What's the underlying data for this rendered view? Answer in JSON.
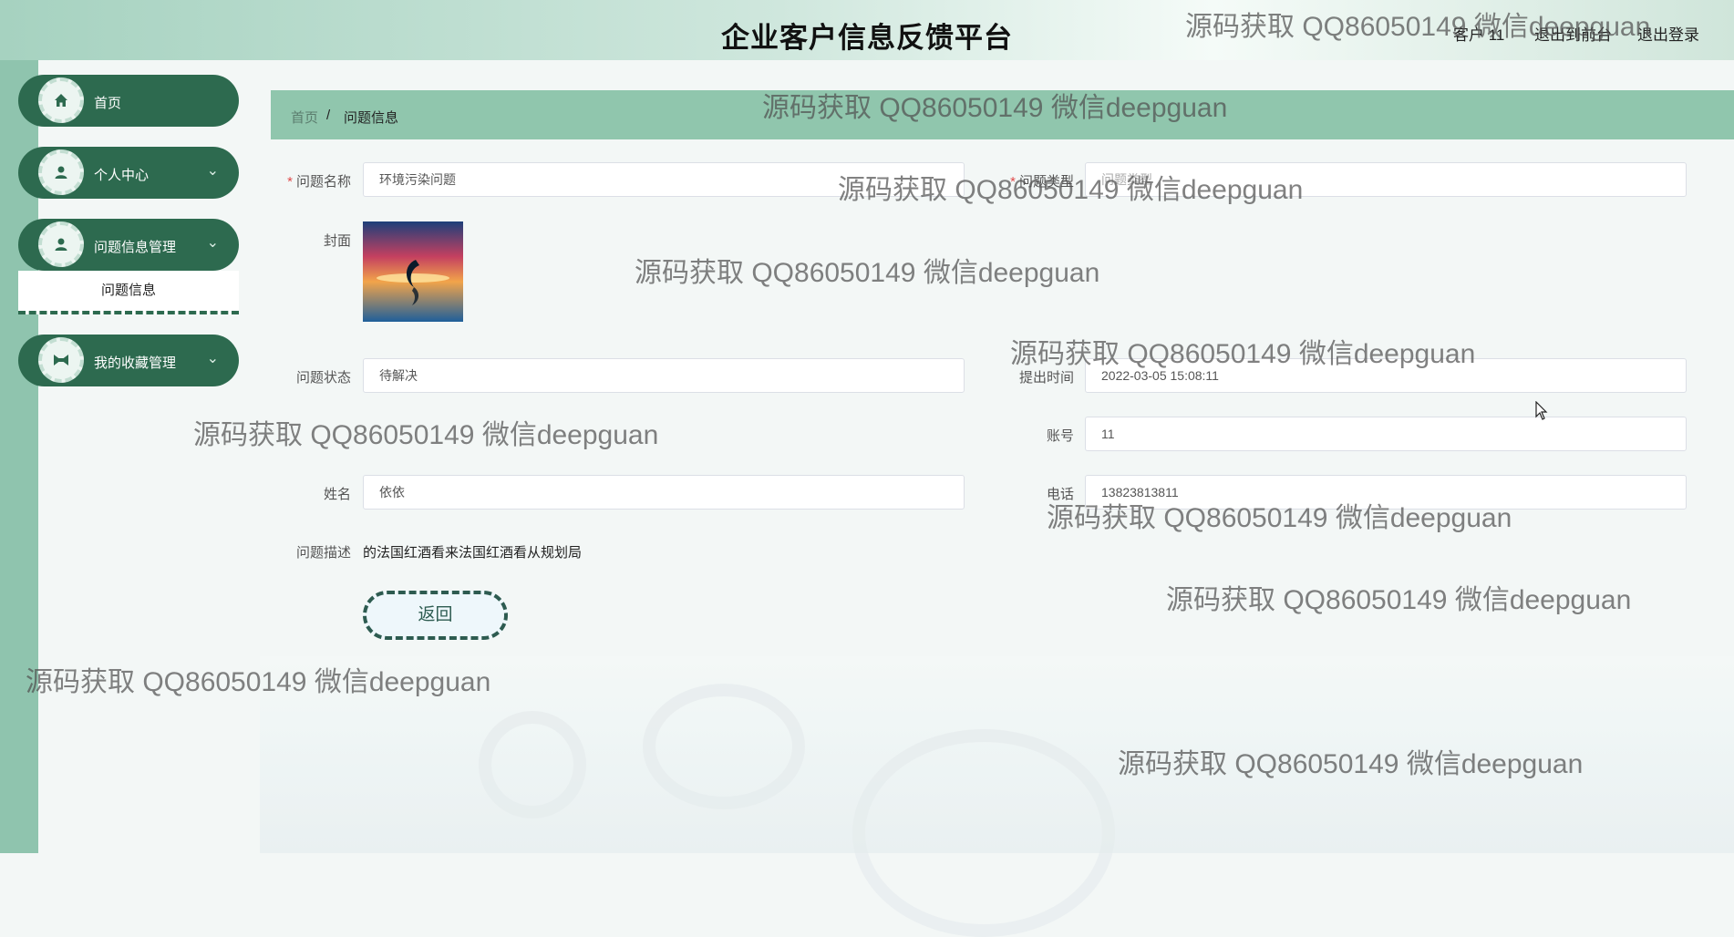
{
  "header": {
    "title": "企业客户信息反馈平台",
    "user_label": "客户 11",
    "front_link": "退出到前台",
    "logout_link": "退出登录"
  },
  "sidebar": {
    "items": [
      {
        "label": "首页",
        "icon": "home-icon",
        "chevron": ""
      },
      {
        "label": "个人中心",
        "icon": "person-icon",
        "chevron": "⌄"
      },
      {
        "label": "问题信息管理",
        "icon": "person-icon",
        "chevron": "⌄"
      },
      {
        "label": "我的收藏管理",
        "icon": "collect-icon",
        "chevron": "⌄"
      }
    ],
    "submenu_active": "问题信息"
  },
  "breadcrumb": {
    "home": "首页",
    "separator": "/",
    "current": "问题信息"
  },
  "form": {
    "problem_name_label": "问题名称",
    "problem_name_value": "环境污染问题",
    "problem_type_label": "问题类型",
    "problem_type_value": "问题类型",
    "cover_label": "封面",
    "status_label": "问题状态",
    "status_value": "待解决",
    "submit_time_label": "提出时间",
    "submit_time_value": "2022-03-05 15:08:11",
    "account_label": "账号",
    "account_value": "11",
    "name_label": "姓名",
    "name_value": "依依",
    "phone_label": "电话",
    "phone_value": "13823813811",
    "description_label": "问题描述",
    "description_value": "的法国红酒看来法国红酒看从规划局",
    "back_button": "返回",
    "required_mark": "*"
  },
  "watermark_text": "源码获取 QQ86050149 微信deepguan",
  "colors": {
    "primary": "#2d6a4f",
    "breadcrumb_bg": "#90c6ad",
    "left_strip": "#8fc4ae",
    "required": "#e04b4b"
  }
}
